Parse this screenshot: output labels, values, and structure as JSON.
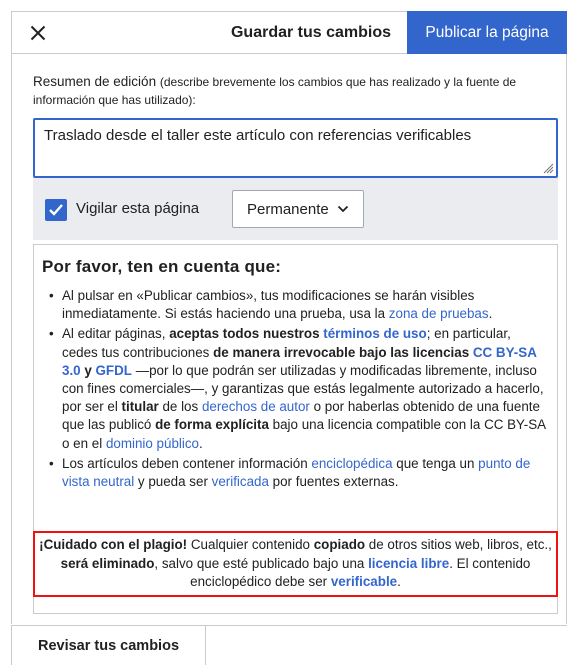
{
  "header": {
    "close_icon": "close-icon",
    "title": "Guardar tus cambios",
    "publish_label": "Publicar la página"
  },
  "summary": {
    "label": "Resumen de edición",
    "hint": "(describe brevemente los cambios que has realizado y la fuente de información que has utilizado):",
    "value": "Traslado desde el taller este artículo con referencias verificables"
  },
  "options": {
    "watch_label": "Vigilar esta página",
    "watch_checked": true,
    "expiry_selected": "Permanente"
  },
  "notice": {
    "title": "Por favor, ten en cuenta que:",
    "item1_a": "Al pulsar en «Publicar cambios», tus modificaciones se harán visibles inmediatamente. Si estás haciendo una prueba, usa la ",
    "item1_link": "zona de pruebas",
    "item1_b": ".",
    "item2_a": "Al editar páginas, ",
    "item2_b": "aceptas todos nuestros ",
    "item2_link_terms": "términos de uso",
    "item2_c": "; en particular, cedes tus contribuciones ",
    "item2_d": "de manera irrevocable bajo las licencias ",
    "item2_link_ccbysa": "CC BY-SA 3.0",
    "item2_e": " y ",
    "item2_link_gfdl": "GFDL",
    "item2_f": " —por lo que podrán ser utilizadas y modificadas libremente, incluso con fines comerciales—, y garantizas que estás legalmente autorizado a hacerlo, por ser el ",
    "item2_g": "titular",
    "item2_h": " de los ",
    "item2_link_copyright": "derechos de autor",
    "item2_i": " o por haberlas obtenido de una fuente que las publicó ",
    "item2_j": "de forma explícita",
    "item2_k": " bajo una licencia compatible con la CC BY-SA o en el ",
    "item2_link_pd": "dominio público",
    "item2_l": ".",
    "item3_a": "Los artículos deben contener información ",
    "item3_link_encyc": "enciclopédica",
    "item3_b": " que tenga un ",
    "item3_link_npov": "punto de vista neutral",
    "item3_c": " y pueda ser ",
    "item3_link_verif": "verificada",
    "item3_d": " por fuentes externas."
  },
  "warning": {
    "a": "¡Cuidado con el plagio!",
    "b": " Cualquier contenido ",
    "c": "copiado",
    "d": " de otros sitios web, libros, etc., ",
    "e": "será eliminado",
    "f": ", salvo que esté publicado bajo una ",
    "link_free": "licencia libre",
    "g": ". El contenido enciclopédico debe ser ",
    "link_verifiable": "verificable",
    "h": "."
  },
  "footer": {
    "review_label": "Revisar tus cambios"
  },
  "colors": {
    "accent": "#3366cc",
    "warning_border": "#ee1111"
  }
}
